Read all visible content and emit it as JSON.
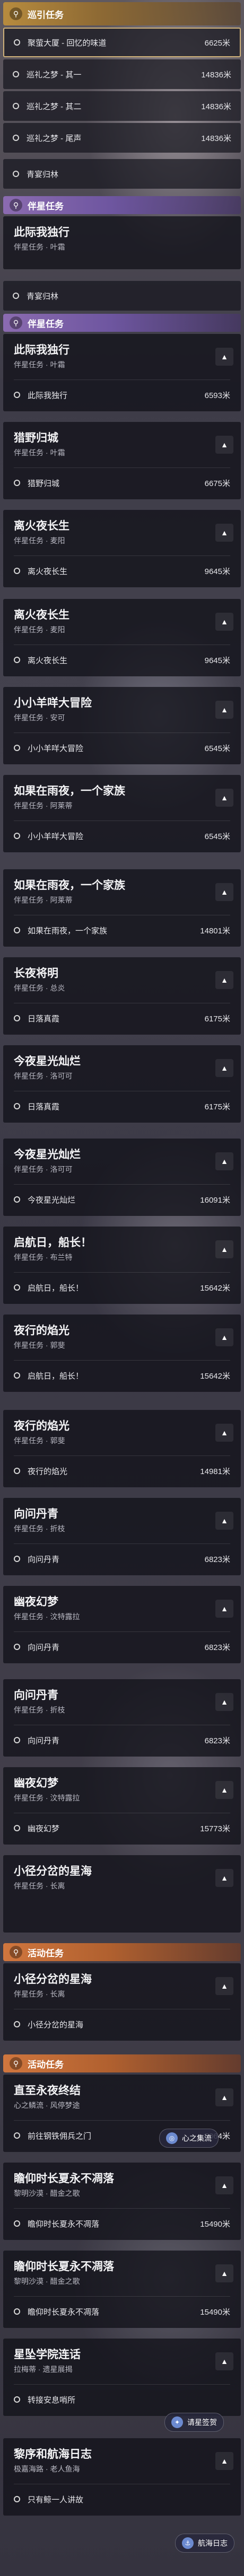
{
  "theme": {
    "gold": "#b78b3e",
    "purple": "#8b6bb0",
    "orange": "#d0763e"
  },
  "trackers": {
    "trail": "巡引任务",
    "companion": "伴星任务",
    "activity": "活动任务"
  },
  "rows": {
    "r1": {
      "label": "聚萤大厦 - 回忆的味道",
      "dist": "6625米"
    },
    "r2": {
      "label": "巡礼之梦 - 其一",
      "dist": "14836米"
    },
    "r3": {
      "label": "巡礼之梦 - 其二",
      "dist": "14836米"
    },
    "r4": {
      "label": "巡礼之梦 - 尾声",
      "dist": "14836米"
    },
    "r5": {
      "label": "青宴归林"
    },
    "r6": {
      "label": "青宴归林"
    }
  },
  "cards": [
    {
      "title": "此际我独行",
      "sub": "伴星任务 · 叶霜",
      "step": "此际我独行",
      "dist": "6593米"
    },
    {
      "title": "猎野归城",
      "sub": "伴星任务 · 叶霜",
      "step": "猎野归城",
      "dist": "6675米"
    },
    {
      "title": "离火夜长生",
      "sub": "伴星任务 · 麦阳",
      "step": "离火夜长生",
      "dist": "9645米"
    },
    {
      "title": "小小羊咩大冒险",
      "sub": "伴星任务 · 安可",
      "step": "小小羊咩大冒险",
      "dist": "6545米"
    },
    {
      "title": "如果在雨夜，一个家族",
      "sub": "伴星任务 · 阿莱蒂",
      "step": "如果在雨夜，一个家族",
      "dist": "14801米"
    },
    {
      "title": "长夜将明",
      "sub": "伴星任务 · 总炎",
      "step": "日落真霞",
      "dist": "6175米"
    },
    {
      "title": "今夜星光灿烂",
      "sub": "伴星任务 · 洛可可",
      "step": "今夜星光灿烂",
      "dist": "16091米"
    },
    {
      "title": "启航日，船长！",
      "sub": "伴星任务 · 布兰特",
      "step": "启航日，船长！",
      "dist": "15642米"
    },
    {
      "title": "夜行的焰光",
      "sub": "伴星任务 · 郭斐",
      "step": "夜行的焰光",
      "dist": "14981米"
    },
    {
      "title": "向问丹青",
      "sub": "伴星任务 · 折枝",
      "step": "向问丹青",
      "dist": "6823米"
    },
    {
      "title": "幽夜幻梦",
      "sub": "伴星任务 · 汶特露拉",
      "step": "幽夜幻梦",
      "dist": "15773米"
    },
    {
      "title": "小径分岔的星海",
      "sub": "伴星任务 · 长离",
      "step": "小径分岔的星海",
      "dist": ""
    },
    {
      "title": "直至永夜终结",
      "sub": "心之鳞流 · 风停梦途",
      "step": "前往钢铁佣兵之门",
      "dist": "5064米"
    },
    {
      "title": "瞻仰时长夏永不凋落",
      "sub": "黎明沙漠 · 醋金之歌",
      "step": "瞻仰时长夏永不凋落",
      "dist": "15490米"
    },
    {
      "title": "瞻仰时长夏永不凋落",
      "sub": "黎明沙漠 · 醋金之歌",
      "step": "瞻仰时长夏永不凋落",
      "dist": "15490米"
    },
    {
      "title": "星坠学院连话",
      "sub": "拉梅蒂 · 遗星展揭",
      "step": "转接安息哨所",
      "dist": ""
    },
    {
      "title": "黎序和航海日志",
      "sub": "极嘉海路 · 老人鱼海",
      "step": "只有鲸一人讲故",
      "dist": ""
    }
  ],
  "buttons": {
    "map": "心之集流",
    "pick": "请星签贺",
    "ship": "航海日志"
  },
  "icons": {
    "pin": "pin-icon",
    "chev": "chevron-icon",
    "pack": "pack-icon"
  }
}
